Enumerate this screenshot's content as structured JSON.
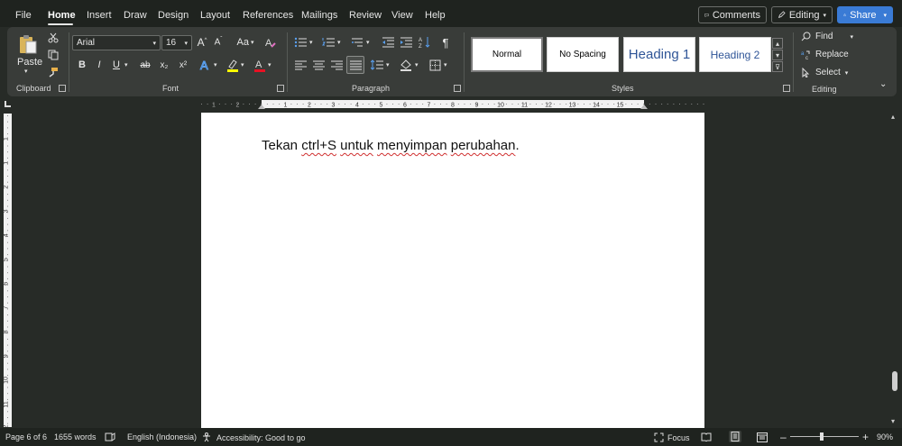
{
  "menu": {
    "tabs": [
      "File",
      "Home",
      "Insert",
      "Draw",
      "Design",
      "Layout",
      "References",
      "Mailings",
      "Review",
      "View",
      "Help"
    ],
    "active_tab": "Home",
    "comments_label": "Comments",
    "editing_label": "Editing",
    "share_label": "Share"
  },
  "ribbon": {
    "clipboard": {
      "paste_label": "Paste",
      "group_label": "Clipboard"
    },
    "font": {
      "family": "Arial",
      "size": "16",
      "change_case_label": "Aa",
      "group_label": "Font",
      "bold": "B",
      "italic": "I",
      "underline": "U",
      "strike": "ab",
      "subscript": "x₂",
      "superscript": "x²",
      "highlight_color": "#ffff00",
      "font_color": "#e81123"
    },
    "paragraph": {
      "group_label": "Paragraph"
    },
    "styles": {
      "group_label": "Styles",
      "items": [
        "Normal",
        "No Spacing",
        "Heading 1",
        "Heading 2"
      ],
      "heading_color": "#2f5597"
    },
    "editing": {
      "group_label": "Editing",
      "find_label": "Find",
      "replace_label": "Replace",
      "select_label": "Select"
    }
  },
  "ruler": {
    "h_labels": [
      "1",
      "2",
      "1",
      "2",
      "3",
      "4",
      "5",
      "6",
      "7",
      "8",
      "9",
      "10",
      "11",
      "12",
      "13",
      "14",
      "15"
    ],
    "v_labels": [
      "1",
      "1",
      "2",
      "3",
      "4",
      "5",
      "6",
      "7",
      "8",
      "9",
      "10",
      "11",
      "12"
    ]
  },
  "document": {
    "words": [
      {
        "text": "Tekan",
        "spell": false
      },
      {
        "text": "ctrl+S",
        "spell": true
      },
      {
        "text": "untuk",
        "spell": true
      },
      {
        "text": "menyimpan",
        "spell": true
      },
      {
        "text": "perubahan",
        "spell": true
      },
      {
        "text": ".",
        "spell": false
      }
    ]
  },
  "status": {
    "page": "Page 6 of 6",
    "words": "1655 words",
    "language": "English (Indonesia)",
    "accessibility": "Accessibility: Good to go",
    "focus": "Focus",
    "zoom": "90%"
  }
}
